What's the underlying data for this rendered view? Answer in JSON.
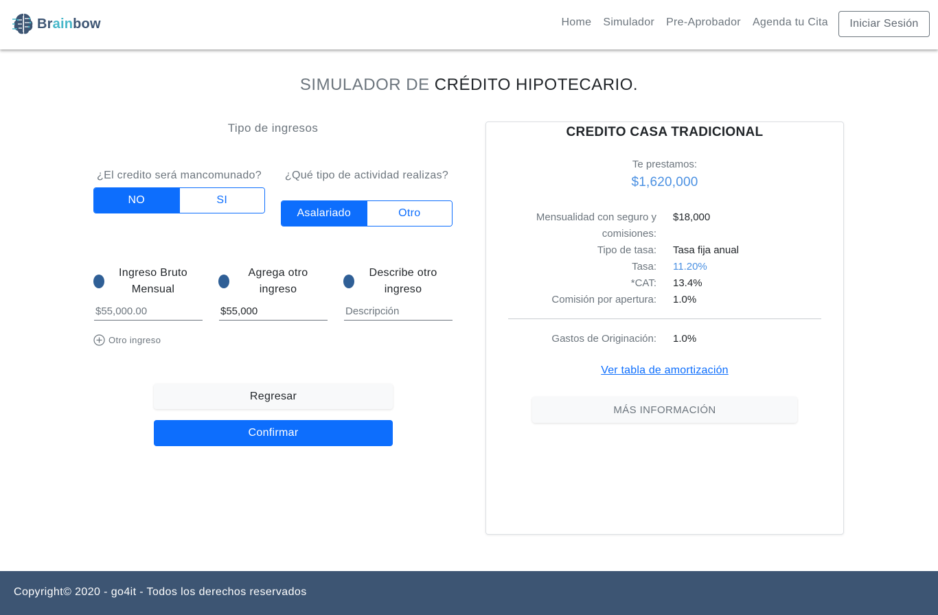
{
  "header": {
    "brand": {
      "part1": "Br",
      "part2": "ain",
      "part3": "bow",
      "icon": "brain-circuit-icon"
    },
    "nav": [
      {
        "label": "Home"
      },
      {
        "label": "Simulador"
      },
      {
        "label": "Pre-Aprobador"
      },
      {
        "label": "Agenda tu Cita"
      }
    ],
    "login_label": "Iniciar Sesión"
  },
  "title": {
    "part1": "SIMULADOR DE ",
    "part2": "CRÉDITO HIPOTECARIO."
  },
  "form": {
    "section_title": "Tipo de ingresos",
    "mancomunado": {
      "question": "¿El credito será mancomunado?",
      "options": [
        "NO",
        "SI"
      ],
      "selected": "NO"
    },
    "actividad": {
      "question": "¿Qué tipo de actividad realizas?",
      "options": [
        "Asalariado",
        "Otro"
      ],
      "selected": "Asalariado"
    },
    "incomes": [
      {
        "label": "Ingreso Bruto Mensual",
        "value": "",
        "placeholder": "$55,000.00"
      },
      {
        "label": "Agrega otro ingreso",
        "value": "$55,000",
        "placeholder": ""
      },
      {
        "label": "Describe otro ingreso",
        "value": "",
        "placeholder": "Descripción"
      }
    ],
    "add_income_label": "Otro ingreso",
    "back_label": "Regresar",
    "confirm_label": "Confirmar"
  },
  "card": {
    "title": "CREDITO CASA TRADICIONAL",
    "loan_label": "Te prestamos:",
    "loan_amount": "$1,620,000",
    "details": [
      {
        "key": "Mensualidad con seguro y comisiones:",
        "value": "$18,000"
      },
      {
        "key": "Tipo de tasa:",
        "value": "Tasa fija anual"
      },
      {
        "key": "Tasa:",
        "value": "11.20%"
      },
      {
        "key": "*CAT:",
        "value": "13.4%"
      },
      {
        "key": "Comisión por apertura:",
        "value": "1.0%"
      }
    ],
    "gastos": {
      "key": "Gastos de Originación:",
      "value": "1.0%"
    },
    "amort_link": "Ver tabla de amortización",
    "more_label": "MÁS INFORMACIÓN"
  },
  "footer": {
    "text": "Copyright© 2020 - go4it - Todos los derechos reservados"
  },
  "colors": {
    "primary": "#0d6efd",
    "footer": "#3d5573",
    "accent_blue": "#4a90e2"
  }
}
